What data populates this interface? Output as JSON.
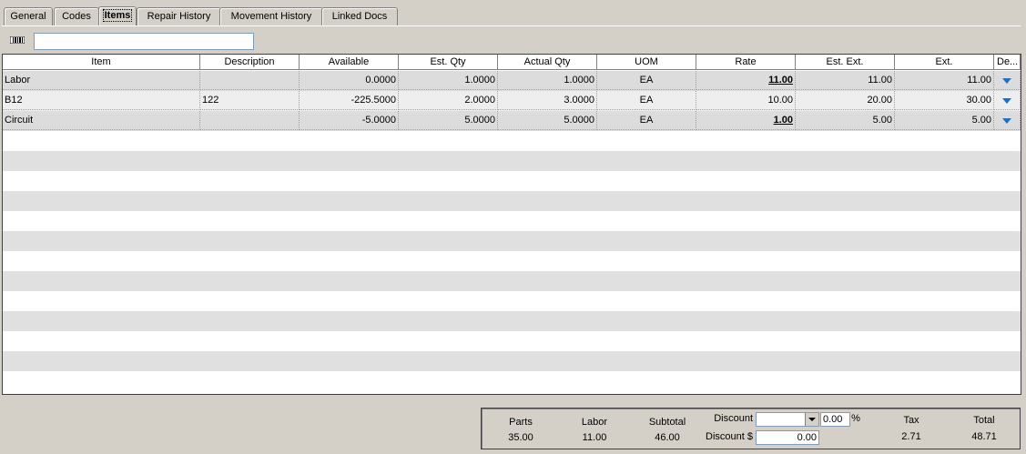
{
  "tabs": [
    {
      "label": "General"
    },
    {
      "label": "Codes"
    },
    {
      "label": "Items",
      "active": true
    },
    {
      "label": "Repair History"
    },
    {
      "label": "Movement History"
    },
    {
      "label": "Linked Docs"
    }
  ],
  "toolbar": {
    "barcode_icon": "barcode-icon",
    "filter_value": ""
  },
  "grid": {
    "columns": [
      "Item",
      "Description",
      "Available",
      "Est. Qty",
      "Actual Qty",
      "UOM",
      "Rate",
      "Est. Ext.",
      "Ext.",
      "De..."
    ],
    "rows": [
      {
        "item": "Labor",
        "description": "",
        "available": "0.0000",
        "est_qty": "1.0000",
        "actual_qty": "1.0000",
        "uom": "EA",
        "rate": "11.00",
        "rate_link": true,
        "est_ext": "11.00",
        "ext": "11.00",
        "detail_icon": "chevron-down-icon"
      },
      {
        "item": "B12",
        "description": "122",
        "available": "-225.5000",
        "est_qty": "2.0000",
        "actual_qty": "3.0000",
        "uom": "EA",
        "rate": "10.00",
        "rate_link": false,
        "est_ext": "20.00",
        "ext": "30.00",
        "detail_icon": "chevron-down-icon"
      },
      {
        "item": "Circuit",
        "description": "",
        "available": "-5.0000",
        "est_qty": "5.0000",
        "actual_qty": "5.0000",
        "uom": "EA",
        "rate": "1.00",
        "rate_link": true,
        "est_ext": "5.00",
        "ext": "5.00",
        "detail_icon": "chevron-down-icon"
      }
    ],
    "icon_color": "#1f6fc4"
  },
  "summary": {
    "parts_label": "Parts",
    "parts_value": "35.00",
    "labor_label": "Labor",
    "labor_value": "11.00",
    "subtotal_label": "Subtotal",
    "subtotal_value": "46.00",
    "discount_label": "Discount",
    "discount_select_value": "",
    "discount_pct_value": "0.00",
    "pct_symbol": "%",
    "discount_amt_label": "Discount $",
    "discount_amt_value": "0.00",
    "tax_label": "Tax",
    "tax_value": "2.71",
    "total_label": "Total",
    "total_value": "48.71"
  }
}
